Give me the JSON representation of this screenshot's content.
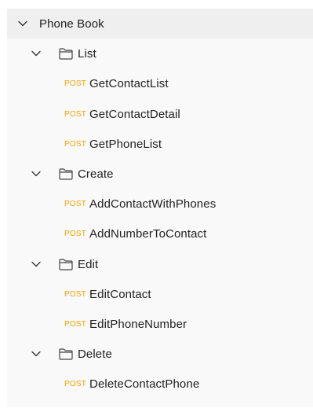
{
  "collection": {
    "name": "Phone Book",
    "folders": [
      {
        "name": "List",
        "requests": [
          {
            "method": "POST",
            "name": "GetContactList"
          },
          {
            "method": "POST",
            "name": "GetContactDetail"
          },
          {
            "method": "POST",
            "name": "GetPhoneList"
          }
        ]
      },
      {
        "name": "Create",
        "requests": [
          {
            "method": "POST",
            "name": "AddContactWithPhones"
          },
          {
            "method": "POST",
            "name": "AddNumberToContact"
          }
        ]
      },
      {
        "name": "Edit",
        "requests": [
          {
            "method": "POST",
            "name": "EditContact"
          },
          {
            "method": "POST",
            "name": "EditPhoneNumber"
          }
        ]
      },
      {
        "name": "Delete",
        "requests": [
          {
            "method": "POST",
            "name": "DeleteContactPhone"
          }
        ]
      }
    ]
  },
  "icons": {
    "expand": "chevron-down-icon",
    "folder": "folder-icon"
  },
  "colors": {
    "method_post": "#f0a500",
    "root_row_bg": "#efefef",
    "panel_bg": "#f9f9f9",
    "text": "#212121"
  }
}
